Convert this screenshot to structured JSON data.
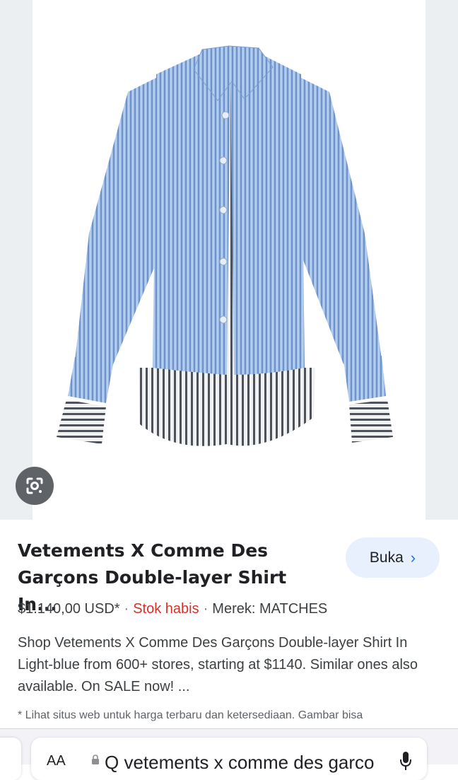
{
  "product": {
    "title": "Vetements X Comme Des Garçons Double-layer Shirt In...",
    "price": "$1.140,00 USD*",
    "separator": "·",
    "stock": "Stok habis",
    "brand": "Merek: MATCHES",
    "description": "Shop Vetements X Comme Des Garçons Double-layer Shirt In Light-blue from 600+ stores, starting at $1140. Similar ones also available. On SALE now! ...",
    "disclaimer": "* Lihat situs web untuk harga terbaru dan ketersediaan. Gambar bisa"
  },
  "actions": {
    "open_label": "Buka",
    "open_chevron": "›"
  },
  "image": {
    "lens_icon": "google-lens-icon",
    "shirt_color": "#8fb1dc",
    "stripe_color": "#5a5e66"
  },
  "browser": {
    "text_size_label": "AA",
    "url": "Q vetements x comme des garco"
  },
  "colors": {
    "accent": "#1a73e8",
    "out_of_stock": "#d93025",
    "button_bg": "#e8f0fe"
  }
}
